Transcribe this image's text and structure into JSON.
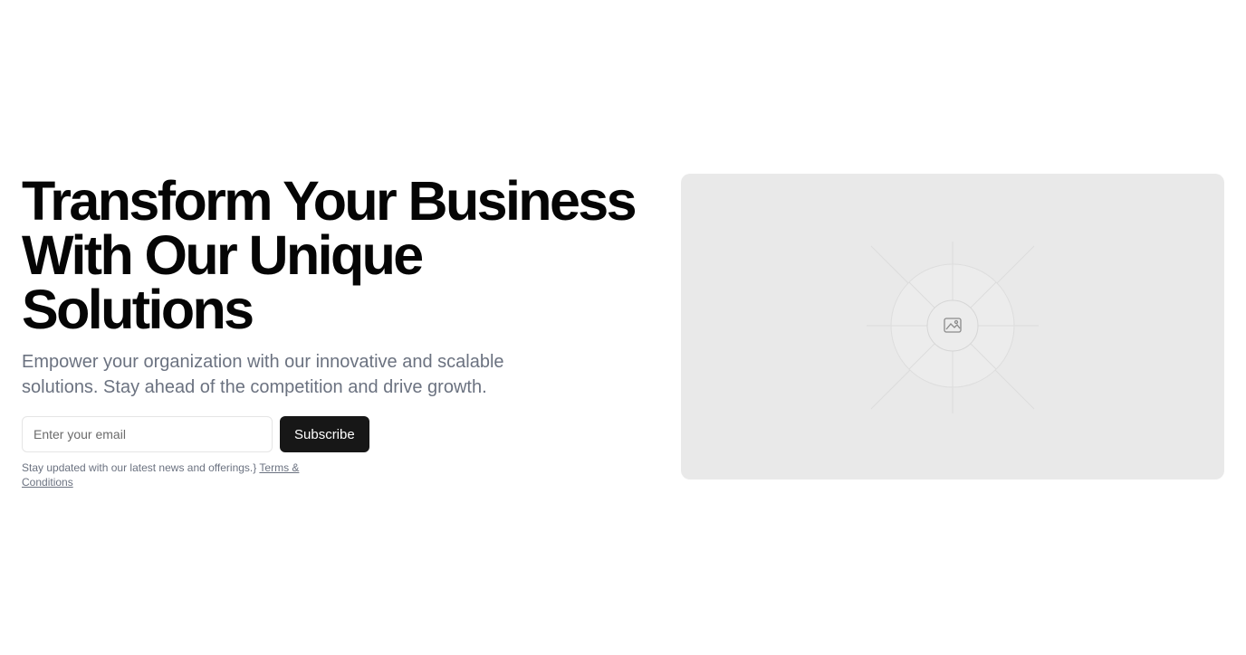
{
  "hero": {
    "headline_lines": [
      "Transform Your Business",
      "With Our Unique",
      "Solutions"
    ],
    "subtext": "Empower your organization with our innovative and scalable solutions. Stay ahead of the competition and drive growth.",
    "email_placeholder": "Enter your email",
    "email_value": "",
    "subscribe_label": "Subscribe",
    "fineprint_text": "Stay updated with our latest news and offerings.}",
    "terms_link": "Terms & Conditions"
  },
  "media": {
    "icon": "image-icon",
    "background_color": "#e9e9e9"
  },
  "colors": {
    "button_bg": "#171717",
    "muted_text": "#6b7280"
  }
}
